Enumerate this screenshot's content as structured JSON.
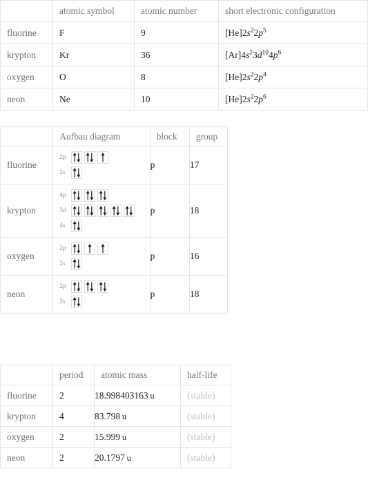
{
  "table_properties": {
    "headers": [
      "",
      "atomic symbol",
      "atomic number",
      "short electronic configuration"
    ],
    "rows": [
      {
        "element": "fluorine",
        "atomic_symbol": "F",
        "atomic_number": "9",
        "short_electronic_configuration": "[He]2s^2 2p^5",
        "config_parts": [
          {
            "text": "[He]2",
            "style": "plain"
          },
          {
            "text": "s",
            "style": "italic"
          },
          {
            "text": "2",
            "style": "sup"
          },
          {
            "text": "2",
            "style": "plain"
          },
          {
            "text": "p",
            "style": "italic"
          },
          {
            "text": "5",
            "style": "sup"
          }
        ]
      },
      {
        "element": "krypton",
        "atomic_symbol": "Kr",
        "atomic_number": "36",
        "short_electronic_configuration": "[Ar]4s^2 3d^10 4p^6",
        "config_parts": [
          {
            "text": "[Ar]4",
            "style": "plain"
          },
          {
            "text": "s",
            "style": "italic"
          },
          {
            "text": "2",
            "style": "sup"
          },
          {
            "text": "3",
            "style": "plain"
          },
          {
            "text": "d",
            "style": "italic"
          },
          {
            "text": "10",
            "style": "sup"
          },
          {
            "text": "4",
            "style": "plain"
          },
          {
            "text": "p",
            "style": "italic"
          },
          {
            "text": "6",
            "style": "sup"
          }
        ]
      },
      {
        "element": "oxygen",
        "atomic_symbol": "O",
        "atomic_number": "8",
        "short_electronic_configuration": "[He]2s^2 2p^4",
        "config_parts": [
          {
            "text": "[He]2",
            "style": "plain"
          },
          {
            "text": "s",
            "style": "italic"
          },
          {
            "text": "2",
            "style": "sup"
          },
          {
            "text": "2",
            "style": "plain"
          },
          {
            "text": "p",
            "style": "italic"
          },
          {
            "text": "4",
            "style": "sup"
          }
        ]
      },
      {
        "element": "neon",
        "atomic_symbol": "Ne",
        "atomic_number": "10",
        "short_electronic_configuration": "[He]2s^2 2p^6",
        "config_parts": [
          {
            "text": "[He]2",
            "style": "plain"
          },
          {
            "text": "s",
            "style": "italic"
          },
          {
            "text": "2",
            "style": "sup"
          },
          {
            "text": "2",
            "style": "plain"
          },
          {
            "text": "p",
            "style": "italic"
          },
          {
            "text": "6",
            "style": "sup"
          }
        ]
      }
    ]
  },
  "table_aufbau": {
    "headers": [
      "",
      "Aufbau diagram",
      "block",
      "group"
    ],
    "rows": [
      {
        "element": "fluorine",
        "block": "p",
        "group": "17",
        "shells": [
          {
            "label_n": "2",
            "label_l": "p",
            "orbitals": [
              "updown",
              "updown",
              "up"
            ]
          },
          {
            "label_n": "2",
            "label_l": "s",
            "orbitals": [
              "updown"
            ]
          }
        ]
      },
      {
        "element": "krypton",
        "block": "p",
        "group": "18",
        "shells": [
          {
            "label_n": "4",
            "label_l": "p",
            "orbitals": [
              "updown",
              "updown",
              "updown"
            ]
          },
          {
            "label_n": "3",
            "label_l": "d",
            "orbitals": [
              "updown",
              "updown",
              "updown",
              "updown",
              "updown"
            ]
          },
          {
            "label_n": "4",
            "label_l": "s",
            "orbitals": [
              "updown"
            ]
          }
        ]
      },
      {
        "element": "oxygen",
        "block": "p",
        "group": "16",
        "shells": [
          {
            "label_n": "2",
            "label_l": "p",
            "orbitals": [
              "updown",
              "up",
              "up"
            ]
          },
          {
            "label_n": "2",
            "label_l": "s",
            "orbitals": [
              "updown"
            ]
          }
        ]
      },
      {
        "element": "neon",
        "block": "p",
        "group": "18",
        "shells": [
          {
            "label_n": "2",
            "label_l": "p",
            "orbitals": [
              "updown",
              "updown",
              "updown"
            ]
          },
          {
            "label_n": "2",
            "label_l": "s",
            "orbitals": [
              "updown"
            ]
          }
        ]
      }
    ]
  },
  "table_physical": {
    "headers": [
      "",
      "period",
      "atomic mass",
      "half-life"
    ],
    "rows": [
      {
        "element": "fluorine",
        "period": "2",
        "atomic_mass": "18.998403163",
        "unit": "u",
        "half_life": "(stable)"
      },
      {
        "element": "krypton",
        "period": "4",
        "atomic_mass": "83.798",
        "unit": "u",
        "half_life": "(stable)"
      },
      {
        "element": "oxygen",
        "period": "2",
        "atomic_mass": "15.999",
        "unit": "u",
        "half_life": "(stable)"
      },
      {
        "element": "neon",
        "period": "2",
        "atomic_mass": "20.1797",
        "unit": "u",
        "half_life": "(stable)"
      }
    ]
  },
  "colors": {
    "border": "#e4e4e4",
    "header_text": "#757575",
    "row_label_text": "#6e6e6e",
    "value_text": "#232323",
    "muted_text": "#bcbcbc",
    "orbital_box_border": "#dcdcdc",
    "arrow": "#1a1a1a",
    "background": "#ffffff"
  }
}
